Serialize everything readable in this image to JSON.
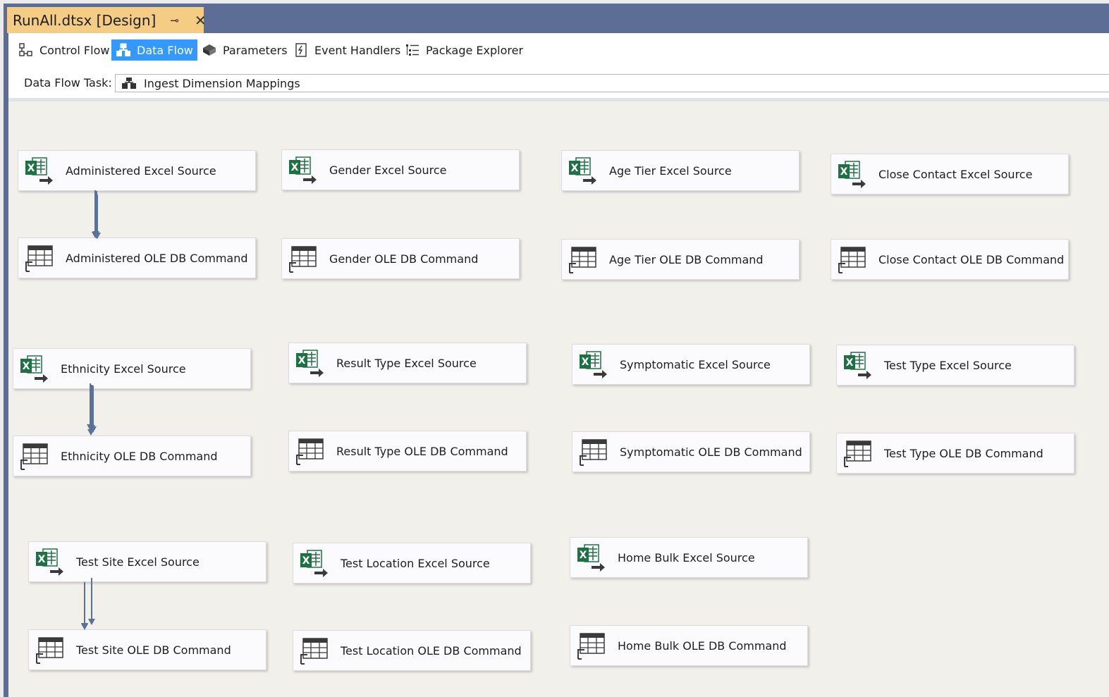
{
  "document_tab": {
    "title": "RunAll.dtsx [Design]",
    "pin_glyph": "⊸",
    "close_glyph": "✕"
  },
  "designer_tabs": [
    {
      "label": "Control Flow",
      "icon": "control-flow-icon",
      "active": false
    },
    {
      "label": "Data Flow",
      "icon": "data-flow-icon",
      "active": true
    },
    {
      "label": "Parameters",
      "icon": "parameters-icon",
      "active": false
    },
    {
      "label": "Event Handlers",
      "icon": "event-handlers-icon",
      "active": false
    },
    {
      "label": "Package Explorer",
      "icon": "package-explorer-icon",
      "active": false
    }
  ],
  "task": {
    "label": "Data Flow Task:",
    "value": "Ingest Dimension Mappings",
    "icon": "data-flow-task-icon"
  },
  "colors": {
    "tab_bar": "#5c6e96",
    "active_doc_tab": "#f5cc84",
    "active_designer_tab": "#3399ff",
    "canvas": "#f2f0eb",
    "connector": "#5a7296",
    "excel_green": "#1e7145"
  },
  "components": [
    {
      "source": "Administered Excel Source",
      "command": "Administered OLE DB Command"
    },
    {
      "source": "Gender Excel Source",
      "command": "Gender OLE DB Command"
    },
    {
      "source": "Age Tier Excel Source",
      "command": "Age Tier OLE DB Command"
    },
    {
      "source": "Close Contact Excel Source",
      "command": "Close Contact OLE DB Command"
    },
    {
      "source": "Ethnicity Excel Source",
      "command": "Ethnicity OLE DB Command"
    },
    {
      "source": "Result Type Excel Source",
      "command": "Result Type OLE DB Command"
    },
    {
      "source": "Symptomatic Excel Source",
      "command": "Symptomatic OLE DB Command"
    },
    {
      "source": "Test Type Excel Source",
      "command": "Test Type OLE DB Command"
    },
    {
      "source": "Test Site Excel Source",
      "command": "Test Site OLE DB Command"
    },
    {
      "source": "Test Location Excel Source",
      "command": "Test Location OLE DB Command"
    },
    {
      "source": "Home Bulk Excel Source",
      "command": "Home Bulk OLE DB Command"
    }
  ]
}
